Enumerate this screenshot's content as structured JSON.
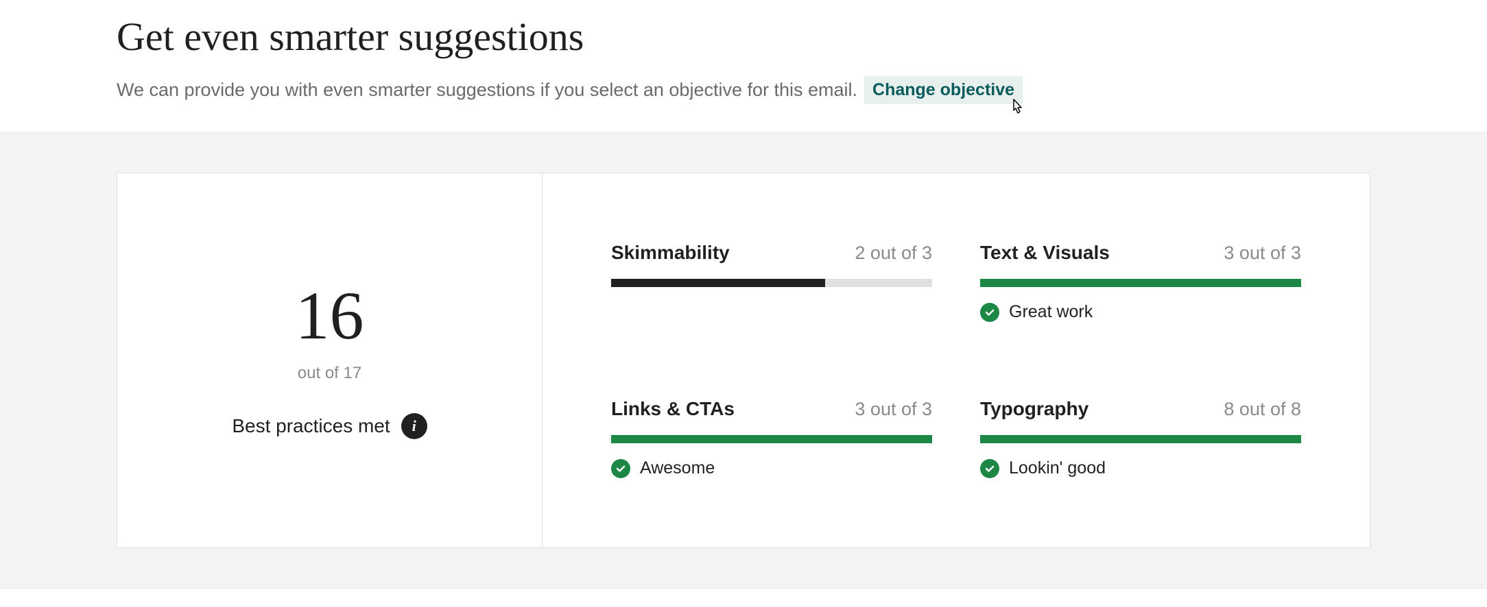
{
  "header": {
    "title": "Get even smarter suggestions",
    "subtitle": "We can provide you with even smarter suggestions if you select an objective for this email.",
    "change_objective_label": "Change objective"
  },
  "summary": {
    "score": "16",
    "out_of": "out of 17",
    "label": "Best practices met"
  },
  "metrics": [
    {
      "name": "Skimmability",
      "score_text": "2 out of 3",
      "fill_percent": 66.67,
      "color": "dark",
      "status": null
    },
    {
      "name": "Text & Visuals",
      "score_text": "3 out of 3",
      "fill_percent": 100,
      "color": "green",
      "status": "Great work"
    },
    {
      "name": "Links & CTAs",
      "score_text": "3 out of 3",
      "fill_percent": 100,
      "color": "green",
      "status": "Awesome"
    },
    {
      "name": "Typography",
      "score_text": "8 out of 8",
      "fill_percent": 100,
      "color": "green",
      "status": "Lookin' good"
    }
  ]
}
